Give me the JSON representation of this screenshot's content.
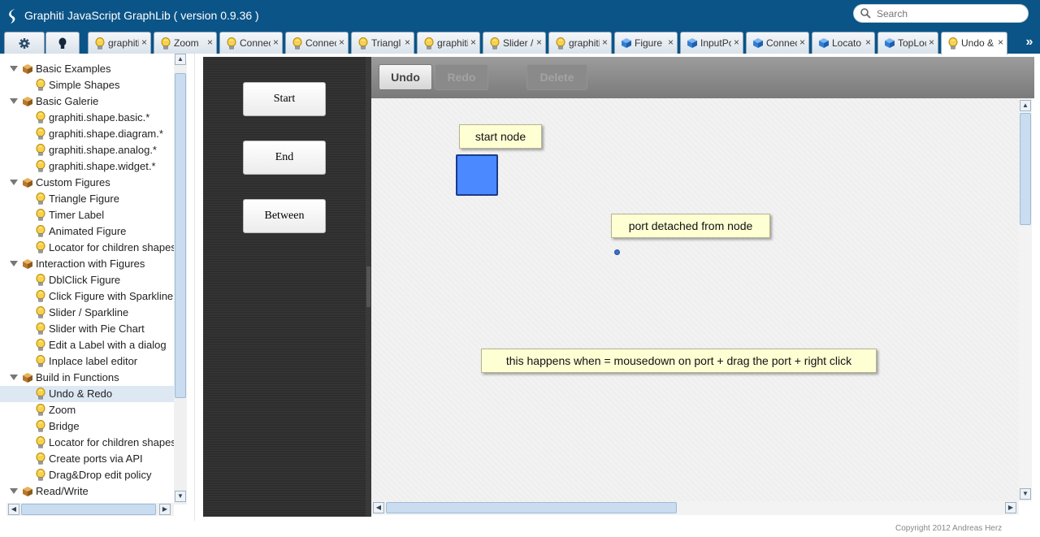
{
  "header": {
    "title": "Graphiti JavaScript GraphLib ( version 0.9.36 )",
    "search_placeholder": "Search",
    "logo_icon": "swirl-logo-icon"
  },
  "tabs": [
    {
      "label": "",
      "icon": "gear-icon",
      "closable": false
    },
    {
      "label": "",
      "icon": "bulb-icon",
      "closable": false
    },
    {
      "label": "graphiti",
      "icon": "bulb-icon",
      "closable": true
    },
    {
      "label": "Zoom",
      "icon": "bulb-icon",
      "closable": true
    },
    {
      "label": "Connec",
      "icon": "bulb-icon",
      "closable": true
    },
    {
      "label": "Connec",
      "icon": "bulb-icon",
      "closable": true
    },
    {
      "label": "Triangl",
      "icon": "bulb-icon",
      "closable": true
    },
    {
      "label": "graphiti",
      "icon": "bulb-icon",
      "closable": true
    },
    {
      "label": "Slider /",
      "icon": "bulb-icon",
      "closable": true
    },
    {
      "label": "graphiti",
      "icon": "bulb-icon",
      "closable": true
    },
    {
      "label": "Figure",
      "icon": "cube-icon",
      "closable": true
    },
    {
      "label": "InputPo",
      "icon": "cube-icon",
      "closable": true
    },
    {
      "label": "Connec",
      "icon": "cube-icon",
      "closable": true
    },
    {
      "label": "Locato",
      "icon": "cube-icon",
      "closable": true
    },
    {
      "label": "TopLoc",
      "icon": "cube-icon",
      "closable": true
    },
    {
      "label": "Undo &",
      "icon": "bulb-icon",
      "closable": true,
      "active": true
    }
  ],
  "tabs_close_glyph": "×",
  "tabs_more_glyph": "»",
  "tree": [
    {
      "type": "group",
      "label": "Basic Examples"
    },
    {
      "type": "leaf",
      "label": "Simple Shapes"
    },
    {
      "type": "group",
      "label": "Basic Galerie"
    },
    {
      "type": "leaf",
      "label": "graphiti.shape.basic.*"
    },
    {
      "type": "leaf",
      "label": "graphiti.shape.diagram.*"
    },
    {
      "type": "leaf",
      "label": "graphiti.shape.analog.*"
    },
    {
      "type": "leaf",
      "label": "graphiti.shape.widget.*"
    },
    {
      "type": "group",
      "label": "Custom Figures"
    },
    {
      "type": "leaf",
      "label": "Triangle Figure"
    },
    {
      "type": "leaf",
      "label": "Timer Label"
    },
    {
      "type": "leaf",
      "label": "Animated Figure"
    },
    {
      "type": "leaf",
      "label": "Locator for children shapes"
    },
    {
      "type": "group",
      "label": "Interaction with Figures"
    },
    {
      "type": "leaf",
      "label": "DblClick Figure"
    },
    {
      "type": "leaf",
      "label": "Click Figure with Sparkline"
    },
    {
      "type": "leaf",
      "label": "Slider / Sparkline"
    },
    {
      "type": "leaf",
      "label": "Slider with Pie Chart"
    },
    {
      "type": "leaf",
      "label": "Edit a Label with a dialog"
    },
    {
      "type": "leaf",
      "label": "Inplace label editor"
    },
    {
      "type": "group",
      "label": "Build in Functions"
    },
    {
      "type": "leaf",
      "label": "Undo & Redo",
      "selected": true
    },
    {
      "type": "leaf",
      "label": "Zoom"
    },
    {
      "type": "leaf",
      "label": "Bridge"
    },
    {
      "type": "leaf",
      "label": "Locator for children shapes"
    },
    {
      "type": "leaf",
      "label": "Create ports via API"
    },
    {
      "type": "leaf",
      "label": "Drag&Drop edit policy"
    },
    {
      "type": "group",
      "label": "Read/Write"
    }
  ],
  "palette": {
    "start": "Start",
    "end": "End",
    "between": "Between"
  },
  "toolbar": {
    "undo": "Undo",
    "redo": "Redo",
    "delete": "Delete"
  },
  "canvas": {
    "start_node_label": "start node",
    "port_label": "port detached from node",
    "instruction_label": "this happens when =  mousedown on port + drag the port + right click",
    "node_color": "#4a89ff"
  },
  "footer": {
    "copyright": "Copyright 2012 Andreas Herz"
  },
  "colors": {
    "header_bg": "#0b5487",
    "note_bg": "#ffffd4",
    "selection": "#dde8f3"
  }
}
